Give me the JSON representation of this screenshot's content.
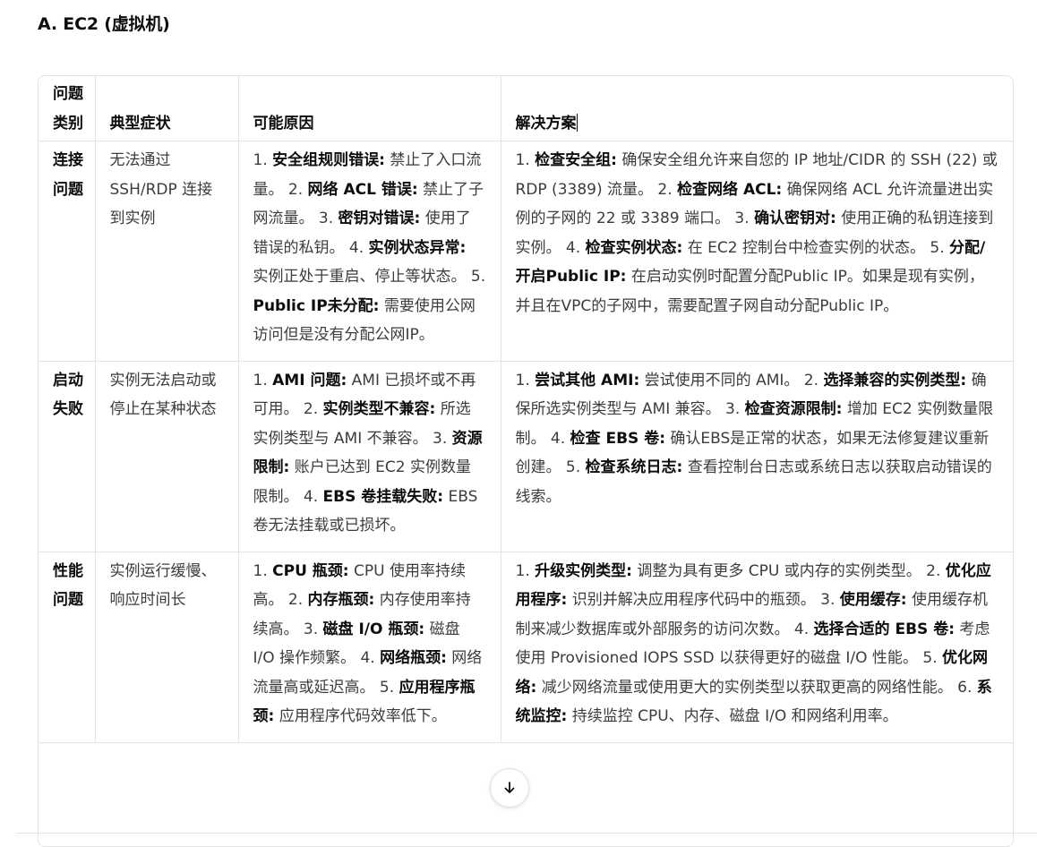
{
  "heading": "A. EC2 (虚拟机)",
  "table": {
    "headers": {
      "category": "问题类别",
      "symptom": "典型症状",
      "cause": "可能原因",
      "solution": "解决方案"
    },
    "rows": [
      {
        "category": "连接问题",
        "symptom": "无法通过 SSH/RDP 连接到实例",
        "causes": [
          {
            "n": "1.",
            "title": "安全组规则错误:",
            "text": "禁止了入口流量。"
          },
          {
            "n": "2.",
            "title": "网络 ACL 错误:",
            "text": "禁止了子网流量。"
          },
          {
            "n": "3.",
            "title": "密钥对错误:",
            "text": "使用了错误的私钥。"
          },
          {
            "n": "4.",
            "title": "实例状态异常:",
            "text": "实例正处于重启、停止等状态。"
          },
          {
            "n": "5.",
            "title": "Public IP未分配:",
            "text": "需要使用公网访问但是没有分配公网IP。"
          }
        ],
        "solutions": [
          {
            "n": "1.",
            "title": "检查安全组:",
            "text": "确保安全组允许来自您的 IP 地址/CIDR 的 SSH (22) 或 RDP (3389) 流量。"
          },
          {
            "n": "2.",
            "title": "检查网络 ACL:",
            "text": "确保网络 ACL 允许流量进出实例的子网的 22 或 3389 端口。"
          },
          {
            "n": "3.",
            "title": "确认密钥对:",
            "text": "使用正确的私钥连接到实例。"
          },
          {
            "n": "4.",
            "title": "检查实例状态:",
            "text": "在 EC2 控制台中检查实例的状态。"
          },
          {
            "n": "5.",
            "title": "分配/开启Public IP:",
            "text": "在启动实例时配置分配Public IP。如果是现有实例，并且在VPC的子网中，需要配置子网自动分配Public IP。"
          }
        ]
      },
      {
        "category": "启动失败",
        "symptom": "实例无法启动或停止在某种状态",
        "causes": [
          {
            "n": "1.",
            "title": "AMI 问题:",
            "text": "AMI 已损坏或不再可用。"
          },
          {
            "n": "2.",
            "title": "实例类型不兼容:",
            "text": "所选实例类型与 AMI 不兼容。"
          },
          {
            "n": "3.",
            "title": "资源限制:",
            "text": "账户已达到 EC2 实例数量限制。"
          },
          {
            "n": "4.",
            "title": "EBS 卷挂载失败:",
            "text": "EBS 卷无法挂载或已损坏。"
          }
        ],
        "solutions": [
          {
            "n": "1.",
            "title": "尝试其他 AMI:",
            "text": "尝试使用不同的 AMI。"
          },
          {
            "n": "2.",
            "title": "选择兼容的实例类型:",
            "text": "确保所选实例类型与 AMI 兼容。"
          },
          {
            "n": "3.",
            "title": "检查资源限制:",
            "text": "增加 EC2 实例数量限制。"
          },
          {
            "n": "4.",
            "title": "检查 EBS 卷:",
            "text": "确认EBS是正常的状态，如果无法修复建议重新创建。"
          },
          {
            "n": "5.",
            "title": "检查系统日志:",
            "text": "查看控制台日志或系统日志以获取启动错误的线索。"
          }
        ]
      },
      {
        "category": "性能问题",
        "symptom": "实例运行缓慢、响应时间长",
        "causes": [
          {
            "n": "1.",
            "title": "CPU 瓶颈:",
            "text": "CPU 使用率持续高。"
          },
          {
            "n": "2.",
            "title": "内存瓶颈:",
            "text": "内存使用率持续高。"
          },
          {
            "n": "3.",
            "title": "磁盘 I/O 瓶颈:",
            "text": "磁盘 I/O 操作频繁。"
          },
          {
            "n": "4.",
            "title": "网络瓶颈:",
            "text": "网络流量高或延迟高。"
          },
          {
            "n": "5.",
            "title": "应用程序瓶颈:",
            "text": "应用程序代码效率低下。"
          }
        ],
        "solutions": [
          {
            "n": "1.",
            "title": "升级实例类型:",
            "text": "调整为具有更多 CPU 或内存的实例类型。"
          },
          {
            "n": "2.",
            "title": "优化应用程序:",
            "text": "识别并解决应用程序代码中的瓶颈。"
          },
          {
            "n": "3.",
            "title": "使用缓存:",
            "text": "使用缓存机制来减少数据库或外部服务的访问次数。"
          },
          {
            "n": "4.",
            "title": "选择合适的 EBS 卷:",
            "text": "考虑使用 Provisioned IOPS SSD 以获得更好的磁盘 I/O 性能。"
          },
          {
            "n": "5.",
            "title": "优化网络:",
            "text": "减少网络流量或使用更大的实例类型以获取更高的网络性能。"
          },
          {
            "n": "6.",
            "title": "系统监控:",
            "text": "持续监控 CPU、内存、磁盘 I/O 和网络利用率。"
          }
        ]
      }
    ]
  },
  "scroll_button": {
    "icon": "arrow-down-icon"
  }
}
